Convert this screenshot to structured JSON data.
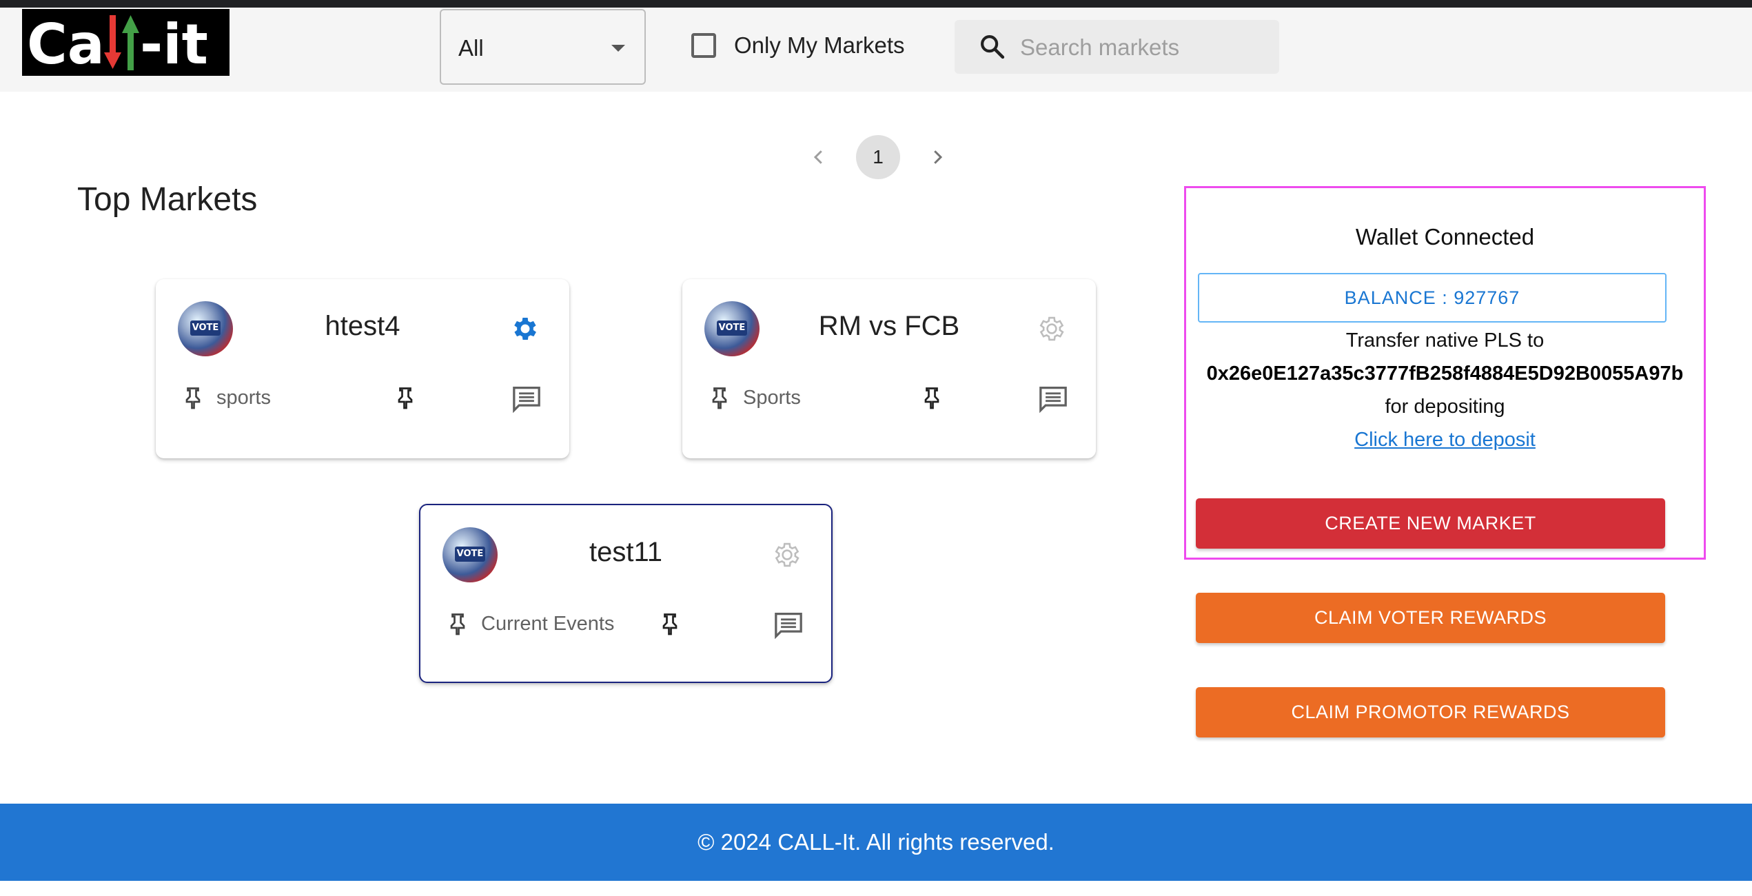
{
  "logo": {
    "text": "Call-it"
  },
  "filter_select": {
    "value": "All"
  },
  "only_my_markets": {
    "label": "Only My Markets",
    "checked": false
  },
  "search": {
    "placeholder": "Search markets"
  },
  "pagination": {
    "current_page": "1"
  },
  "heading": "Top Markets",
  "markets": [
    {
      "title": "htest4",
      "category": "sports",
      "avatar_text": "VOTE",
      "gear_color": "#1976d2"
    },
    {
      "title": "RM vs FCB",
      "category": "Sports",
      "avatar_text": "VOTE",
      "gear_color": "#bdbdbd"
    },
    {
      "title": "test11",
      "category": "Current Events",
      "avatar_text": "VOTE",
      "gear_color": "#bdbdbd"
    }
  ],
  "wallet": {
    "status": "Wallet Connected",
    "balance": "BALANCE : 927767",
    "transfer_text": "Transfer native PLS to",
    "address": "0x26e0E127a35c3777fB258f4884E5D92B0055A97b",
    "for_text": "for depositing",
    "deposit_link": "Click here to deposit"
  },
  "actions": {
    "create": "CREATE NEW MARKET",
    "claim_voter": "CLAIM VOTER REWARDS",
    "claim_promotor": "CLAIM PROMOTOR REWARDS"
  },
  "footer": "© 2024 CALL-It. All rights reserved.",
  "colors": {
    "primary": "#2176d2",
    "create_button": "#d32f38",
    "claim_button": "#ec6c24",
    "highlight_border": "#ee4bee"
  }
}
